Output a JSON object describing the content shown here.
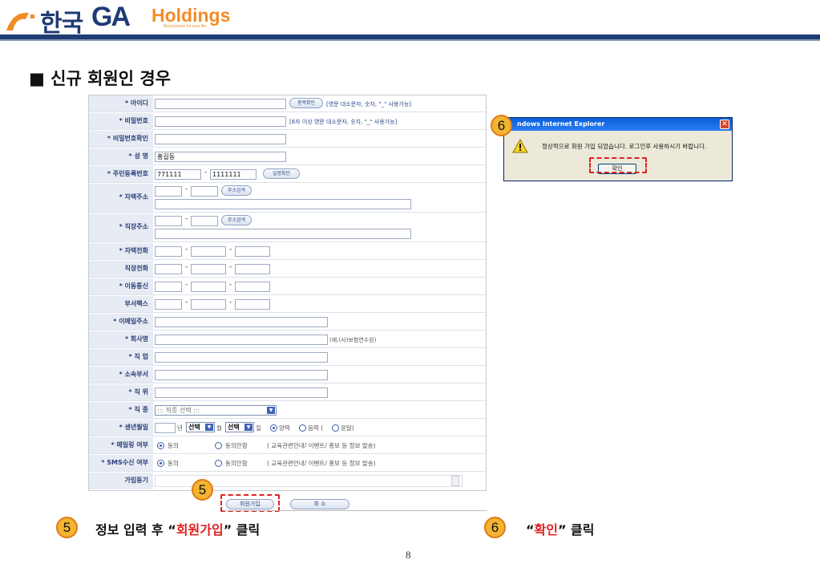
{
  "header": {
    "logo_korean": "한국",
    "logo_ga": "GA",
    "logo_holdings": "Holdings",
    "logo_tagline": "Best partner for your life"
  },
  "section_title": "■ 신규 회원인 경우",
  "form": {
    "id": {
      "label": "* 아이디",
      "button": "중복확인",
      "hint": "[영문 대소문자, 숫자, \"_\" 사용가능]"
    },
    "password": {
      "label": "* 비밀번호",
      "hint": "[6자 이상 영문 대소문자, 숫자, \"_\" 사용가능]"
    },
    "password_confirm": {
      "label": "* 비밀번호확인"
    },
    "name": {
      "label": "* 성 명",
      "value": "홍길동"
    },
    "resident_no": {
      "label": "* 주민등록번호",
      "value1": "771111",
      "dash": "-",
      "value2": "1111111",
      "button": "실명확인"
    },
    "home_address": {
      "label": "* 자택주소",
      "dash": "-",
      "button": "주소검색"
    },
    "work_address": {
      "label": "* 직장주소",
      "dash": "-",
      "button": "주소검색"
    },
    "home_phone": {
      "label": "* 자택전화",
      "dash": "-"
    },
    "work_phone": {
      "label": "직장전화",
      "dash": "-"
    },
    "mobile": {
      "label": "* 이동통신",
      "dash": "-"
    },
    "fax": {
      "label": "부서팩스",
      "dash": "-"
    },
    "email": {
      "label": "* 이메일주소"
    },
    "company": {
      "label": "* 회사명",
      "hint": "(예:(사)보험연수원)"
    },
    "job": {
      "label": "* 직 업"
    },
    "department": {
      "label": "* 소속부서"
    },
    "position": {
      "label": "* 직 위"
    },
    "job_type": {
      "label": "* 직 종",
      "selected": "::: 직종 선택 :::"
    },
    "birthday": {
      "label": "* 생년월일",
      "year_unit": "년",
      "month_select": "선택",
      "month_unit": "월",
      "day_select": "선택",
      "day_unit": "일",
      "solar": "양력",
      "lunar": "음력 (",
      "leap": "윤달)"
    },
    "mail_consent": {
      "label": "* 메일링 여부",
      "agree": "동의",
      "disagree": "동의안함",
      "note": "( 교육관련안내/ 이벤트/ 홍보 등 정보 발송)"
    },
    "sms_consent": {
      "label": "* SMS수신 여부",
      "agree": "동의",
      "disagree": "동의안함",
      "note": "( 교육관련안내/ 이벤트/ 홍보 등 정보 발송)"
    },
    "motive": {
      "label": "가입동기"
    },
    "join_button": "회원가입",
    "cancel_button": "취 소"
  },
  "dialog": {
    "title": "ndows Internet Explorer",
    "close": "✕",
    "message": "정상적으로 회원 가입 되었습니다. 로그인후 사용하시기 바랍니다.",
    "ok": "확인"
  },
  "steps": {
    "five": "5",
    "six": "6"
  },
  "captions": {
    "step5_pre": "정보 입력 후 “",
    "step5_em": "회원가입",
    "step5_post": "” 클릭",
    "step6_pre": "“",
    "step6_em": "확인",
    "step6_post": "” 클릭"
  },
  "page_number": "8",
  "colors": {
    "brand_navy": "#1f3b73",
    "brand_orange": "#f28c28",
    "highlight_red": "#e02020",
    "step_badge": "#f2b431"
  }
}
